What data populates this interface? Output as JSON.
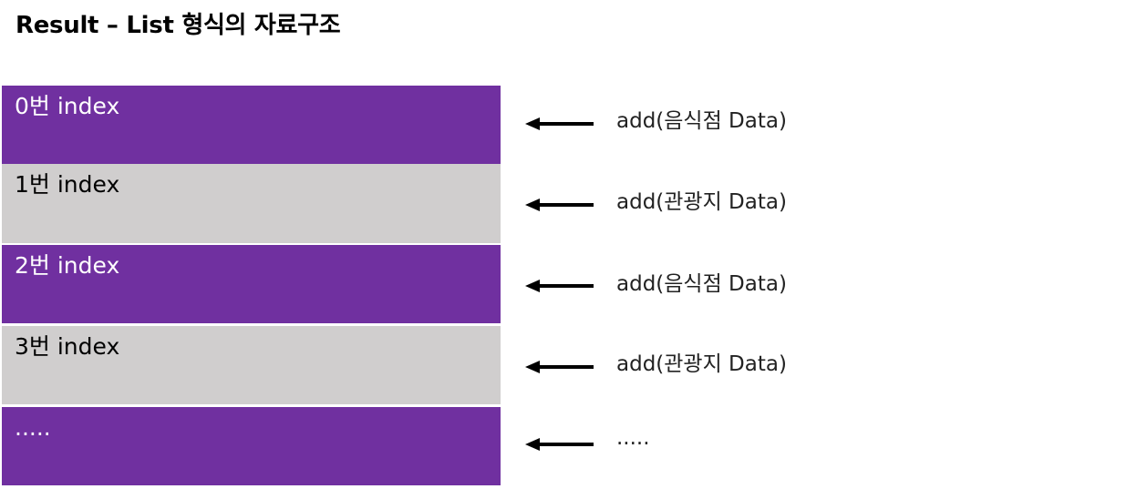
{
  "title": "Result – List 형식의 자료구조",
  "colors": {
    "purple": "#7030a0",
    "gray": "#d0cece",
    "arrow": "#000000"
  },
  "rows": [
    {
      "label": "0번 index",
      "style": "purple",
      "action": "add(음식점 Data)"
    },
    {
      "label": "1번 index",
      "style": "gray",
      "action": "add(관광지 Data)"
    },
    {
      "label": "2번 index",
      "style": "purple",
      "action": "add(음식점 Data)"
    },
    {
      "label": "3번 index",
      "style": "gray",
      "action": "add(관광지 Data)"
    },
    {
      "label": ".....",
      "style": "purple",
      "action": "....."
    }
  ],
  "icons": {
    "arrow": "left-arrow-icon"
  }
}
